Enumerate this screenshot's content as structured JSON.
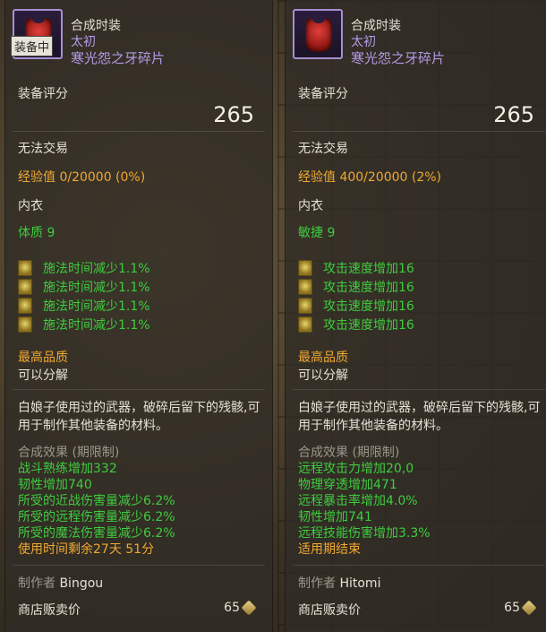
{
  "left": {
    "item_type": "合成时装",
    "tier": "太初",
    "item_name": "寒光怨之牙碎片",
    "equipped_badge": "装备中",
    "score_label": "装备评分",
    "score_value": "265",
    "tradable": "无法交易",
    "exp": "经验值 0/20000 (0%)",
    "slot": "内衣",
    "stat": "体质 9",
    "bonus_lines": [
      "施法时间减少1.1%",
      "施法时间减少1.1%",
      "施法时间减少1.1%",
      "施法时间减少1.1%"
    ],
    "quality": "最高品质",
    "decompose": "可以分解",
    "description": "白娘子使用过的武器，破碎后留下的残骸,可用于制作其他装备的材料。",
    "effect_title": "合成效果 (期限制)",
    "effect_lines": [
      "战斗熟练增加332",
      "韧性增加740",
      "所受的近战伤害量减少6.2%",
      "所受的远程伤害量减少6.2%",
      "所受的魔法伤害量减少6.2%"
    ],
    "effect_foot": "使用时间剩余27天 51分",
    "maker_label": "制作者",
    "maker_name": "Bingou",
    "price_label": "商店贩卖价",
    "price_value": "65"
  },
  "right": {
    "item_type": "合成时装",
    "tier": "太初",
    "item_name": "寒光怨之牙碎片",
    "score_label": "装备评分",
    "score_value": "265",
    "tradable": "无法交易",
    "exp": "经验值 400/20000 (2%)",
    "slot": "内衣",
    "stat": "敏捷 9",
    "bonus_lines": [
      "攻击速度增加16",
      "攻击速度增加16",
      "攻击速度增加16",
      "攻击速度增加16"
    ],
    "quality": "最高品质",
    "decompose": "可以分解",
    "description": "白娘子使用过的武器，破碎后留下的残骸,可用于制作其他装备的材料。",
    "effect_title": "合成效果 (期限制)",
    "effect_lines": [
      "远程攻击力增加20,0",
      "物理穿透增加471",
      "远程暴击率增加4.0%",
      "韧性增加741",
      "远程技能伤害增加3.3%"
    ],
    "effect_foot": "适用期结束",
    "maker_label": "制作者",
    "maker_name": "Hitomi",
    "price_label": "商店贩卖价",
    "price_value": "65"
  },
  "colors": {
    "accent_purple": "#b49ae6",
    "stat_green": "#3ecc3e",
    "highlight_orange": "#f0a832"
  },
  "icons": {
    "item_icon": "armor-icon",
    "bonus_icon": "rune-icon",
    "currency_icon": "coin-icon"
  }
}
